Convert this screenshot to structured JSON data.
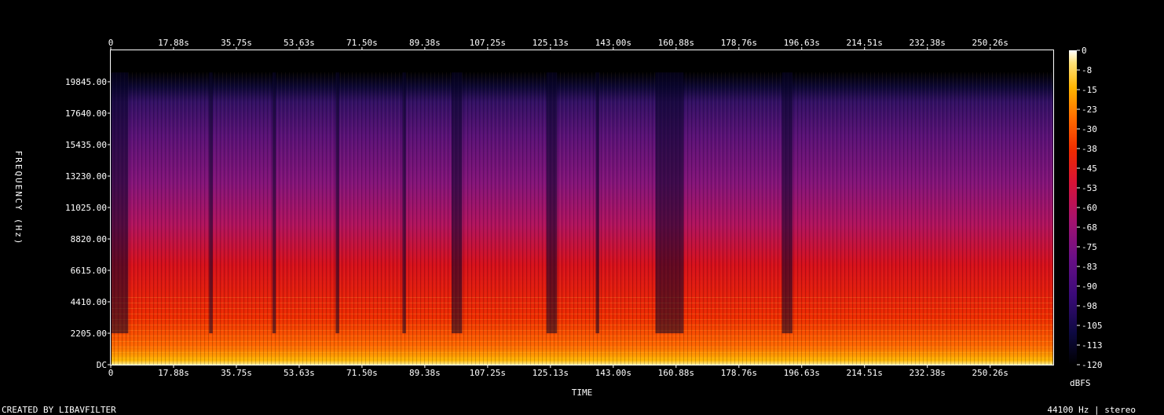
{
  "chart_data": {
    "type": "heatmap",
    "title": "",
    "xlabel": "TIME",
    "ylabel": "FREQUENCY (Hz)",
    "x_ticks": [
      "0",
      "17.88s",
      "35.75s",
      "53.63s",
      "71.50s",
      "89.38s",
      "107.25s",
      "125.13s",
      "143.00s",
      "160.88s",
      "178.76s",
      "196.63s",
      "214.51s",
      "232.38s",
      "250.26s"
    ],
    "y_ticks": [
      "DC",
      "2205.00",
      "4410.00",
      "6615.00",
      "8820.00",
      "11025.00",
      "13230.00",
      "15435.00",
      "17640.00",
      "19845.00"
    ],
    "x_range_s": [
      0,
      268.1
    ],
    "y_range_hz": [
      0,
      22050
    ],
    "colorbar": {
      "label": "dBFS",
      "range": [
        -120,
        0
      ],
      "ticks": [
        "0",
        "-8",
        "-15",
        "-23",
        "-30",
        "-38",
        "-45",
        "-53",
        "-60",
        "-68",
        "-75",
        "-83",
        "-90",
        "-98",
        "-105",
        "-113",
        "-120"
      ],
      "colors": [
        "#000000",
        "#0d0940",
        "#3a0a78",
        "#7a0f8a",
        "#b4126a",
        "#e0181e",
        "#ff5a00",
        "#ffa800",
        "#ffe26a",
        "#ffffff"
      ]
    },
    "quiet_sections_s": [
      [
        0,
        5
      ],
      [
        28,
        29
      ],
      [
        46,
        47
      ],
      [
        64,
        65
      ],
      [
        83,
        84
      ],
      [
        97,
        100
      ],
      [
        124,
        127
      ],
      [
        138,
        139
      ],
      [
        155,
        163
      ],
      [
        191,
        194
      ]
    ],
    "content_end_s": 268.1
  },
  "footer": {
    "left": "CREATED BY LIBAVFILTER",
    "right": "44100 Hz | stereo"
  }
}
